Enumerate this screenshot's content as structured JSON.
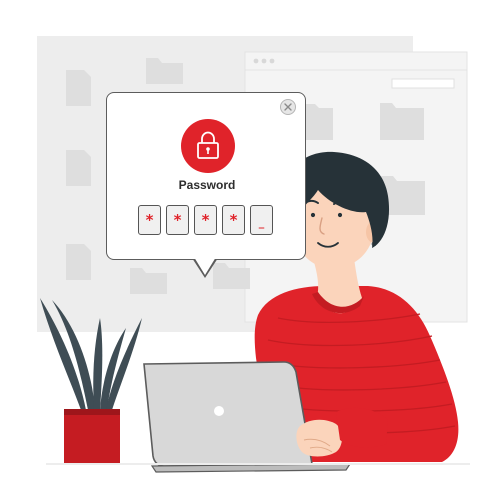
{
  "password_dialog": {
    "title": "Password",
    "pin_chars": [
      "*",
      "*",
      "*",
      "*",
      "_"
    ]
  },
  "colors": {
    "accent": "#e0232a",
    "accent_dark": "#b81a20",
    "panel_bg": "#ebebeb",
    "outline": "#5c5c5c"
  },
  "icons": {
    "lock": "lock-icon",
    "close": "close-icon"
  }
}
